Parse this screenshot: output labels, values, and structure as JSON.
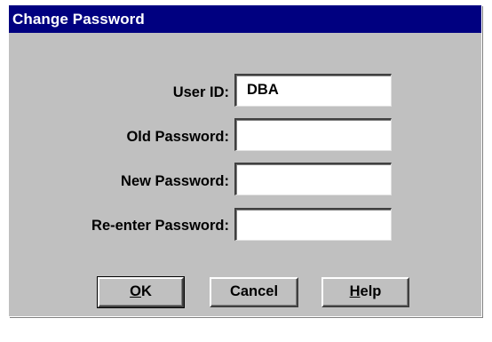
{
  "window": {
    "title": "Change Password"
  },
  "form": {
    "user_id_label": "User ID:",
    "user_id_value": "DBA",
    "old_password_label": "Old Password:",
    "old_password_value": "",
    "new_password_label": "New Password:",
    "new_password_value": "",
    "reenter_password_label": "Re-enter Password:",
    "reenter_password_value": ""
  },
  "buttons": {
    "ok": {
      "mnemonic": "O",
      "rest": "K"
    },
    "cancel": {
      "label": "Cancel"
    },
    "help": {
      "mnemonic": "H",
      "rest": "elp"
    }
  },
  "colors": {
    "titlebar": "#000080",
    "dialog_face": "#c0c0c0",
    "field_bg": "#ffffff"
  }
}
